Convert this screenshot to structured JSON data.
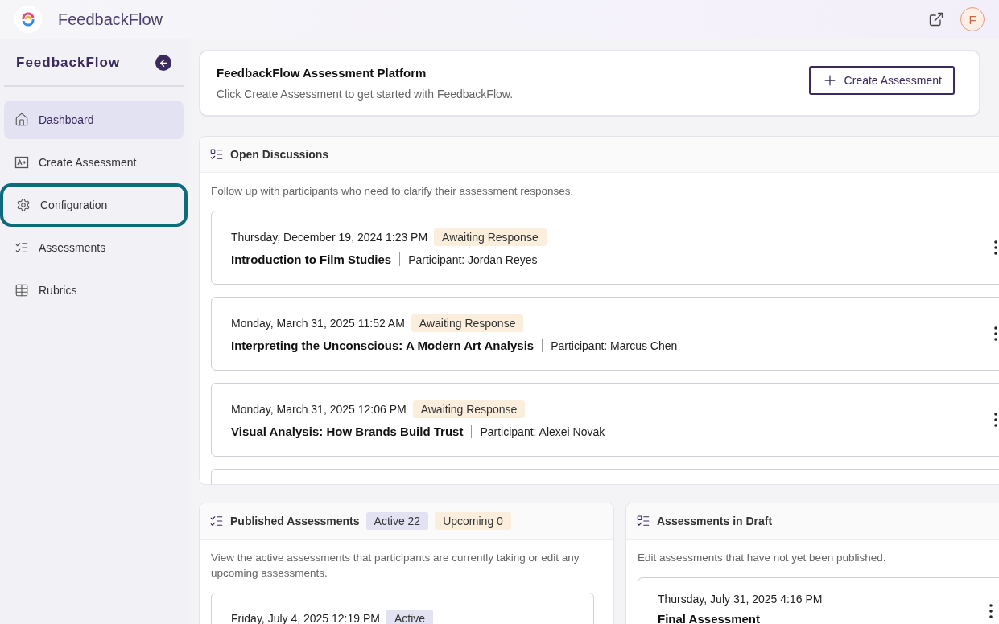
{
  "app": {
    "name": "FeedbackFlow",
    "avatar": "F"
  },
  "sidebar": {
    "title": "FeedbackFlow",
    "items": [
      {
        "label": "Dashboard",
        "selected": true,
        "focused": false
      },
      {
        "label": "Create Assessment",
        "selected": false,
        "focused": false
      },
      {
        "label": "Configuration",
        "selected": false,
        "focused": true
      },
      {
        "label": "Assessments",
        "selected": false,
        "focused": false
      },
      {
        "label": "Rubrics",
        "selected": false,
        "focused": false
      }
    ]
  },
  "hero": {
    "title": "FeedbackFlow Assessment Platform",
    "subtitle": "Click Create Assessment to get started with FeedbackFlow.",
    "button": "Create Assessment"
  },
  "open_discussions": {
    "title": "Open Discussions",
    "description": "Follow up with participants who need to clarify their assessment responses.",
    "items": [
      {
        "date": "Thursday, December 19, 2024 1:23 PM",
        "status": "Awaiting Response",
        "title": "Introduction to Film Studies",
        "participant": "Participant: Jordan Reyes"
      },
      {
        "date": "Monday, March 31, 2025 11:52 AM",
        "status": "Awaiting Response",
        "title": "Interpreting the Unconscious: A Modern Art Analysis",
        "participant": "Participant: Marcus Chen"
      },
      {
        "date": "Monday, March 31, 2025 12:06 PM",
        "status": "Awaiting Response",
        "title": "Visual Analysis: How Brands Build Trust",
        "participant": "Participant: Alexei Novak"
      }
    ]
  },
  "published": {
    "title": "Published Assessments",
    "badges": [
      {
        "label": "Active 22",
        "kind": "active"
      },
      {
        "label": "Upcoming 0",
        "kind": "upcoming"
      }
    ],
    "description": "View the active assessments that participants are currently taking or edit any upcoming assessments.",
    "items": [
      {
        "date": "Friday, July 4, 2025 12:19 PM",
        "status": "Active",
        "kind": "active"
      }
    ]
  },
  "drafts": {
    "title": "Assessments in Draft",
    "description": "Edit assessments that have not yet been published.",
    "items": [
      {
        "date": "Thursday, July 31, 2025 4:16 PM",
        "title": "Final Assessment"
      }
    ]
  }
}
